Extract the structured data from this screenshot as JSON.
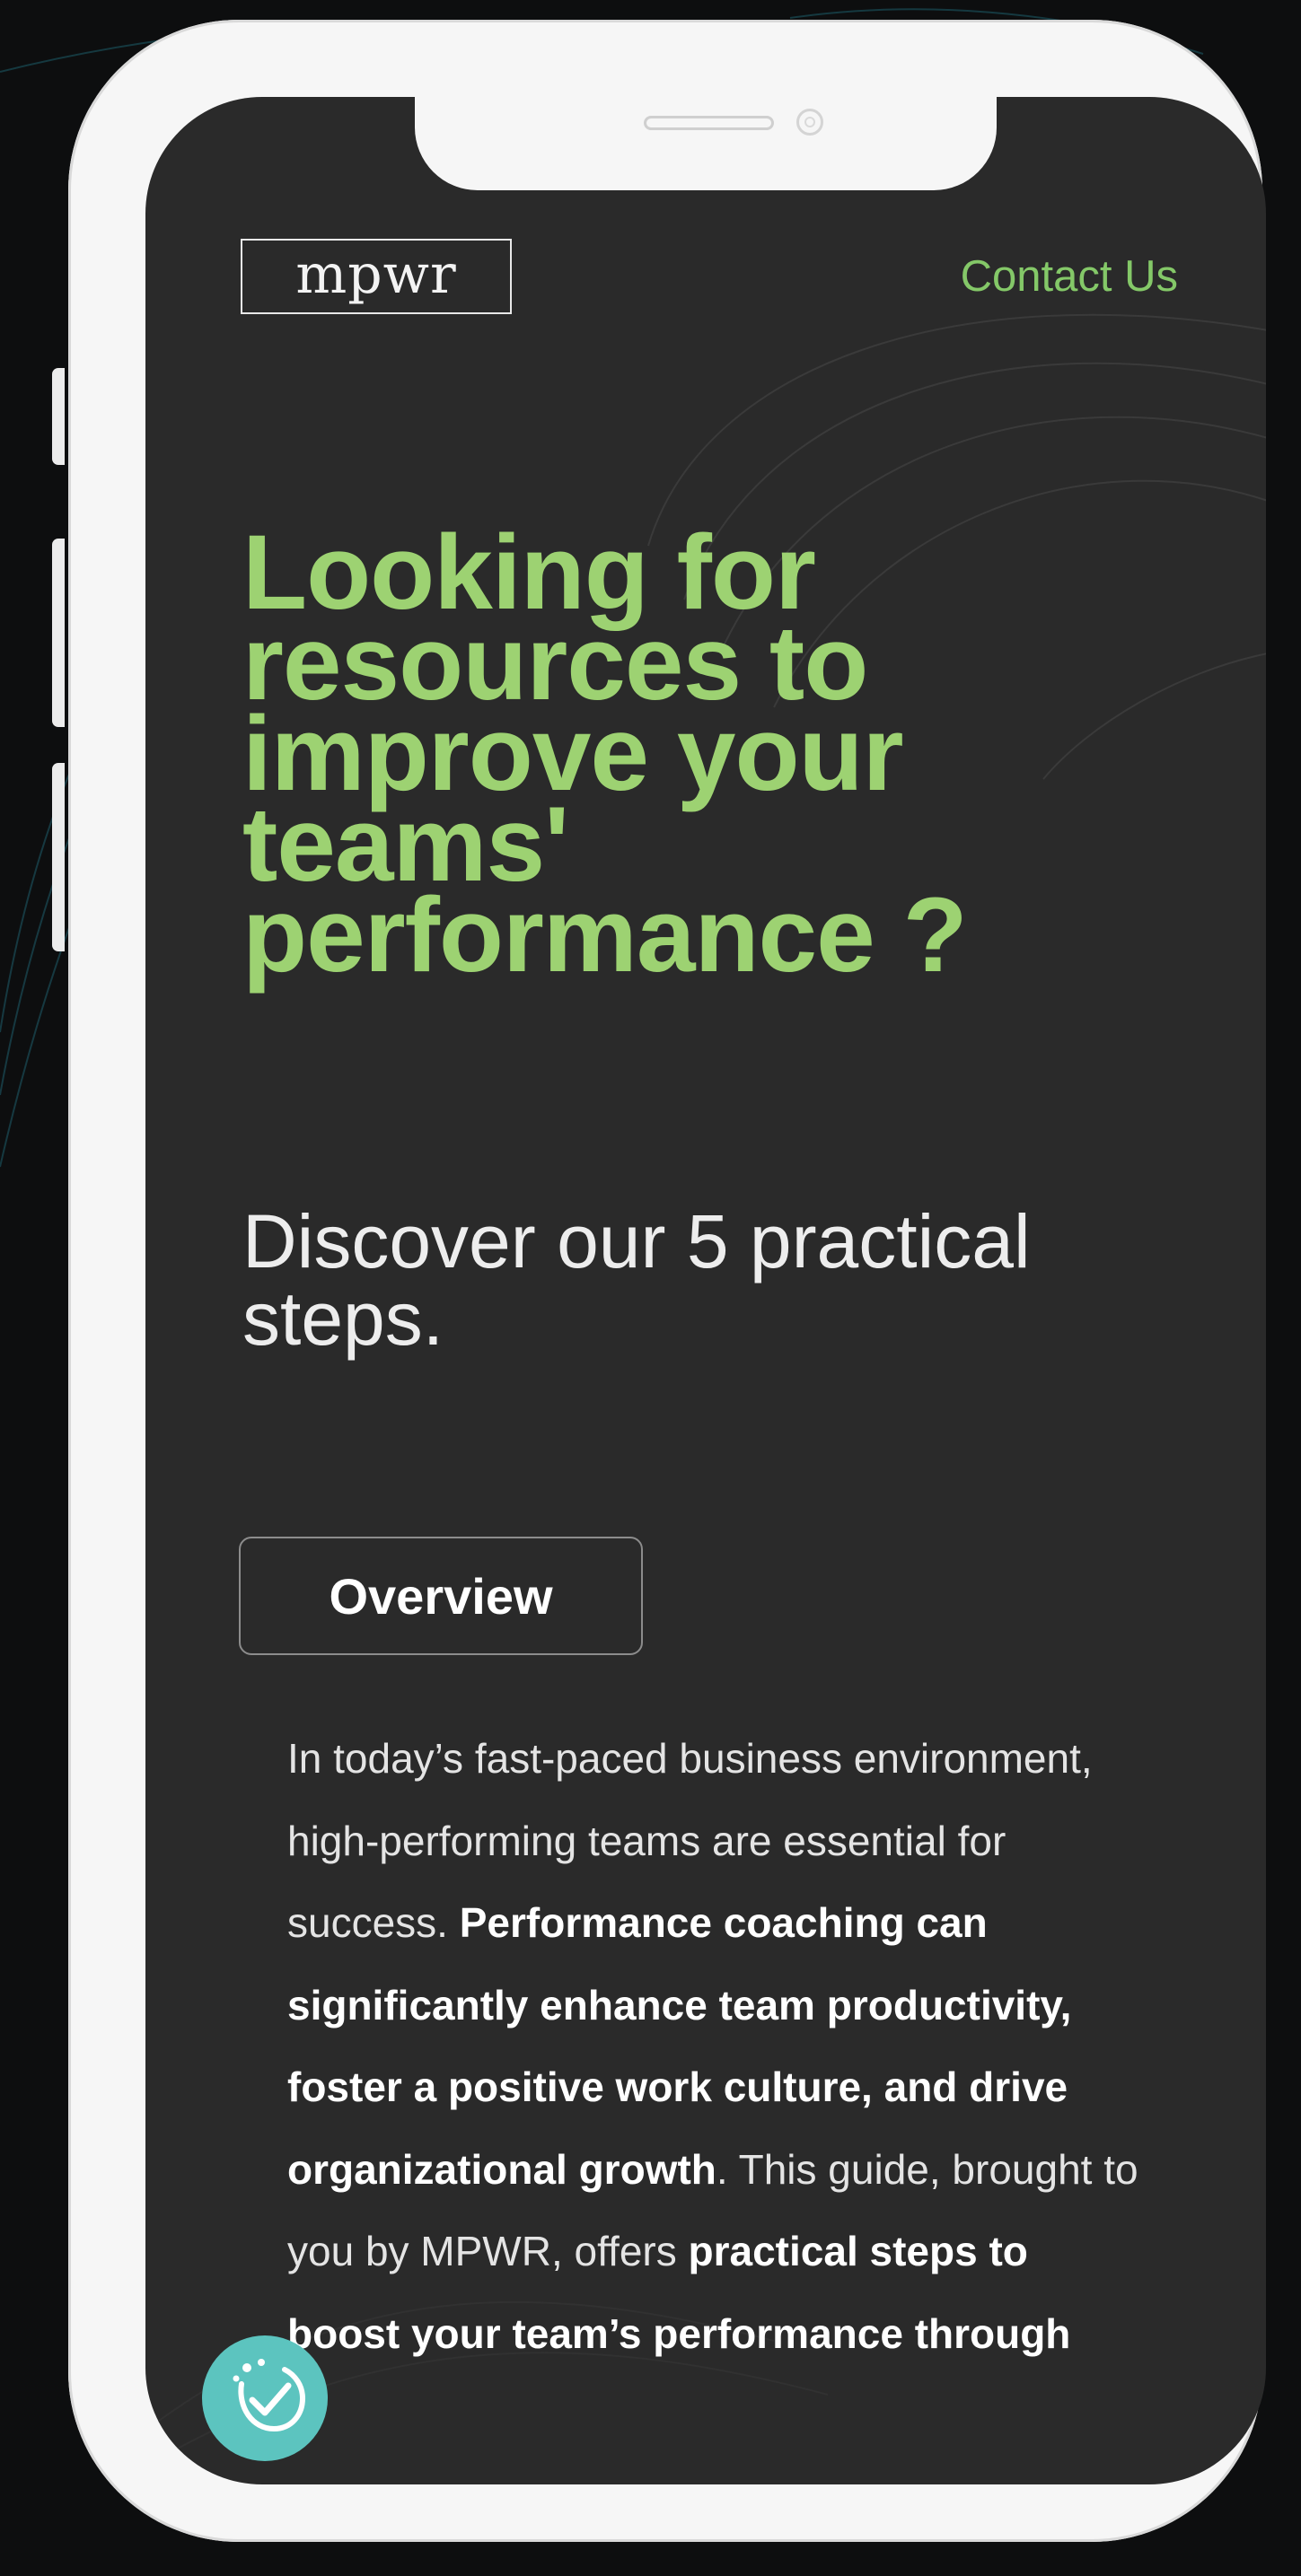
{
  "header": {
    "logo_text": "mpwr",
    "contact_label": "Contact Us"
  },
  "hero": {
    "title": "Looking for resources to improve your teams' performance ?",
    "subtitle": "Discover our 5 practical steps."
  },
  "overview_button": {
    "label": "Overview"
  },
  "body": {
    "p1": "In today’s fast-paced business environment, high-performing teams are essential for success. ",
    "p2_bold": "Performance coaching can significantly enhance team productivity, foster a positive work culture, and drive organizational growth",
    "p3": ". This guide, brought to you by MPWR, offers ",
    "p4_bold": "practical steps to boost your team’s performance through"
  },
  "badge": {
    "icon": "checkmark-badge-icon"
  },
  "colors": {
    "accent_green": "#9dd272",
    "link_green": "#84c868",
    "screen_background": "#2a2a2a",
    "badge_teal": "#5cc4bf"
  }
}
